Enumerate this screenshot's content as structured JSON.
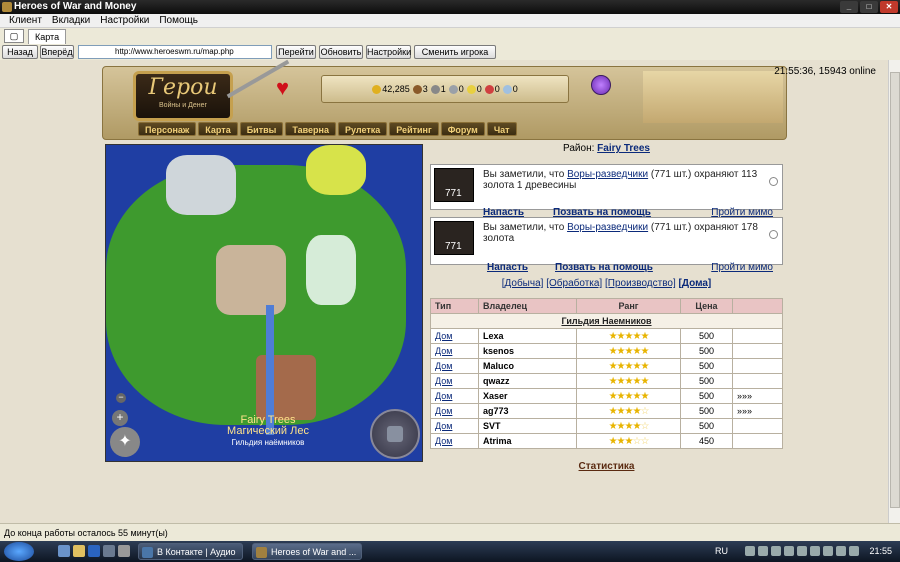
{
  "window": {
    "title": "Heroes of War and Money",
    "controls": [
      "_",
      "□",
      "✕"
    ]
  },
  "menu": [
    "Клиент",
    "Вкладки",
    "Настройки",
    "Помощь"
  ],
  "tab": {
    "label": "Карта"
  },
  "nav": {
    "back": "Назад",
    "forward": "Вперёд",
    "url": "http://www.heroeswm.ru/map.php",
    "go": "Перейти",
    "refresh": "Обновить",
    "settings": "Настройки",
    "switch_player": "Сменить игрока"
  },
  "header": {
    "logo_title": "Герои",
    "logo_subtitle": "Войны и Денег",
    "resources": [
      {
        "icon": "gold-icon",
        "value": "42,285",
        "color": "#e0b020"
      },
      {
        "icon": "wood-icon",
        "value": "3",
        "color": "#8a5a2a"
      },
      {
        "icon": "ore-icon",
        "value": "1",
        "color": "#888888"
      },
      {
        "icon": "mercury-icon",
        "value": "0",
        "color": "#9aa0a8"
      },
      {
        "icon": "sulfur-icon",
        "value": "0",
        "color": "#e8d040"
      },
      {
        "icon": "crystal-icon",
        "value": "0",
        "color": "#d04040"
      },
      {
        "icon": "gem-icon",
        "value": "0",
        "color": "#a0c0e0"
      }
    ],
    "clock": "21:55:36, 15943 online"
  },
  "navtabs": [
    "Персонаж",
    "Карта",
    "Битвы",
    "Таверна",
    "Рулетка",
    "Рейтинг",
    "Форум",
    "Чат"
  ],
  "map": {
    "location": "Fairy Trees",
    "location_ru": "Магический Лес",
    "guild": "Гильдия наёмников",
    "zoom_out": "−",
    "zoom_in": "+",
    "compass": "✦"
  },
  "district": {
    "label": "Район:",
    "name": "Fairy Trees"
  },
  "encounters": [
    {
      "count": "771",
      "text_prefix": "Вы заметили, что",
      "monster": "Воры-разведчики",
      "text_suffix": "(771 шт.) охраняют 113 золота 1 древесины",
      "attack": "Напасть",
      "help": "Позвать на помощь",
      "pass": "Пройти мимо"
    },
    {
      "count": "771",
      "text_prefix": "Вы заметили, что",
      "monster": "Воры-разведчики",
      "text_suffix": "(771 шт.) охраняют 178 золота",
      "attack": "Напасть",
      "help": "Позвать на помощь",
      "pass": "Пройти мимо"
    }
  ],
  "categories": [
    "[Добыча]",
    "[Обработка]",
    "[Производство]",
    "[Дома]"
  ],
  "table": {
    "headers": [
      "Тип",
      "Владелец",
      "Ранг",
      "Цена",
      ""
    ],
    "guild_row": "Гильдия Наемников",
    "rows": [
      {
        "type": "Дом",
        "owner": "Lexa",
        "stars": 5,
        "price": "500",
        "extra": ""
      },
      {
        "type": "Дом",
        "owner": "ksenos",
        "stars": 5,
        "price": "500",
        "extra": ""
      },
      {
        "type": "Дом",
        "owner": "Maluco",
        "stars": 5,
        "price": "500",
        "extra": ""
      },
      {
        "type": "Дом",
        "owner": "qwazz",
        "stars": 5,
        "price": "500",
        "extra": ""
      },
      {
        "type": "Дом",
        "owner": "Xaser",
        "stars": 5,
        "price": "500",
        "extra": "»»»"
      },
      {
        "type": "Дом",
        "owner": "ag773",
        "stars": 4,
        "price": "500",
        "extra": "»»»"
      },
      {
        "type": "Дом",
        "owner": "SVT",
        "stars": 4,
        "price": "500",
        "extra": ""
      },
      {
        "type": "Дом",
        "owner": "Atrima",
        "stars": 3,
        "price": "450",
        "extra": ""
      }
    ]
  },
  "statistics_link": "Статистика",
  "status": "До конца работы осталось 55 минут(ы)",
  "taskbar": {
    "tasks": [
      "В Контакте | Аудио ...",
      "Heroes of War and ..."
    ],
    "lang": "RU",
    "time": "21:55"
  }
}
